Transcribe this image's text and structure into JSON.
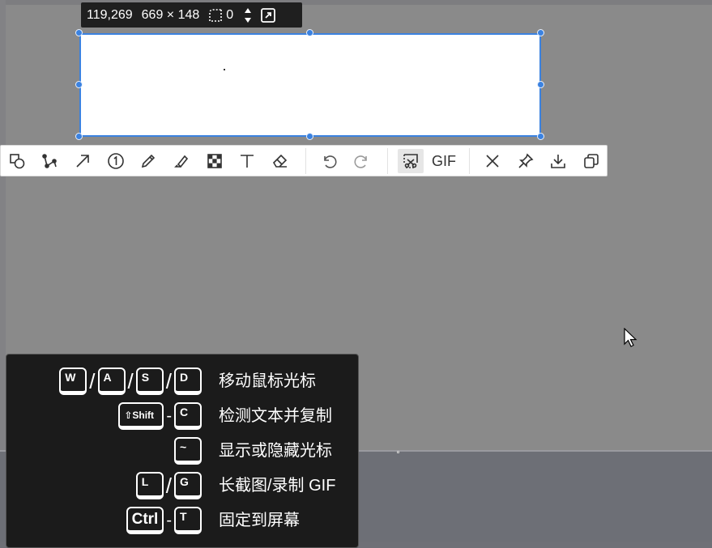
{
  "info_bar": {
    "position": "119,269",
    "size": "669 × 148",
    "radius_value": "0",
    "icons": [
      "corner-radius-icon",
      "stepper-icon",
      "expand-icon"
    ]
  },
  "toolbar": {
    "tools": [
      {
        "name": "shape-tool",
        "icon": "shapes-icon"
      },
      {
        "name": "path-tool",
        "icon": "polyline-icon"
      },
      {
        "name": "arrow-tool",
        "icon": "arrow-icon"
      },
      {
        "name": "number-tool",
        "icon": "circled-one-icon",
        "glyph": "1"
      },
      {
        "name": "pencil-tool",
        "icon": "pencil-icon"
      },
      {
        "name": "marker-tool",
        "icon": "highlighter-icon"
      },
      {
        "name": "mosaic-tool",
        "icon": "mosaic-icon"
      },
      {
        "name": "text-tool",
        "icon": "text-icon"
      },
      {
        "name": "eraser-tool",
        "icon": "eraser-icon"
      }
    ],
    "history": [
      "undo-icon",
      "redo-icon"
    ],
    "capture": [
      {
        "name": "scroll-capture",
        "icon": "scroll-capture-icon",
        "active": true
      },
      {
        "name": "gif-record",
        "label": "GIF"
      }
    ],
    "actions": [
      "close-icon",
      "pin-icon",
      "download-icon",
      "copy-icon"
    ]
  },
  "shortcuts": [
    {
      "keys": [
        "W",
        "A",
        "S",
        "D"
      ],
      "joiner": "/",
      "label": "移动鼠标光标"
    },
    {
      "keys": [
        "⇧Shift",
        "C"
      ],
      "joiner": "-",
      "label": "检测文本并复制"
    },
    {
      "keys": [
        "~"
      ],
      "joiner": "",
      "label": "显示或隐藏光标"
    },
    {
      "keys": [
        "L",
        "G"
      ],
      "joiner": "/",
      "label": "长截图/录制 GIF"
    },
    {
      "keys": [
        "Ctrl",
        "T"
      ],
      "joiner": "-",
      "label": "固定到屏幕"
    }
  ],
  "colors": {
    "accent": "#3b82e0",
    "overlay": "#8a8a8a",
    "panel": "#1b1b1b"
  }
}
